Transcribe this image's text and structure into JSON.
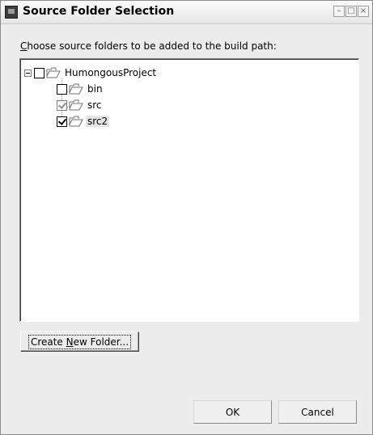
{
  "window": {
    "title": "Source Folder Selection",
    "icon": "eclipse-app-icon",
    "controls": {
      "minimize": "–",
      "maximize": "□",
      "close": "×"
    }
  },
  "dialog": {
    "instruction_prefix": "",
    "instruction_mnemonic": "C",
    "instruction_rest": "hoose source folders to be added to the build path:"
  },
  "tree": {
    "root": {
      "label": "HumongousProject",
      "expanded": true,
      "checked": false
    },
    "children": [
      {
        "label": "bin",
        "checked": false,
        "grayed": false,
        "selected": false
      },
      {
        "label": "src",
        "checked": true,
        "grayed": true,
        "selected": false
      },
      {
        "label": "src2",
        "checked": true,
        "grayed": false,
        "selected": true
      }
    ]
  },
  "buttons": {
    "create_prefix": "Create ",
    "create_mnemonic": "N",
    "create_rest": "ew Folder...",
    "ok": "OK",
    "cancel": "Cancel"
  },
  "colors": {
    "dialog_bg": "#ececec",
    "selection_bg": "#e3e3e3"
  }
}
